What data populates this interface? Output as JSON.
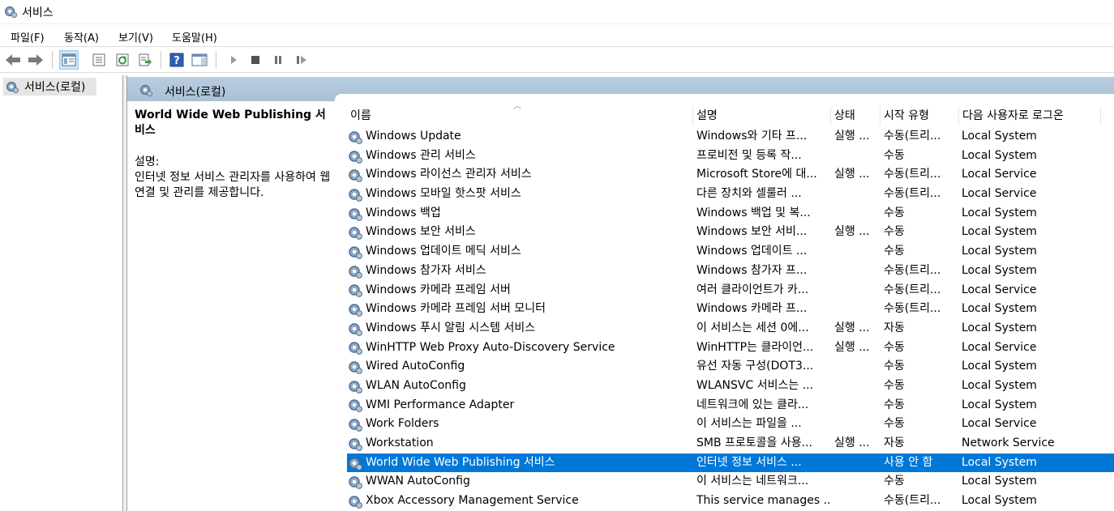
{
  "window": {
    "title": "서비스"
  },
  "menu": [
    {
      "label": "파일(F)"
    },
    {
      "label": "동작(A)"
    },
    {
      "label": "보기(V)"
    },
    {
      "label": "도움말(H)"
    }
  ],
  "toolbar": {
    "buttons": [
      {
        "name": "back-icon"
      },
      {
        "name": "forward-icon"
      },
      {
        "name": "show-hide-console-tree-icon",
        "active": true
      },
      {
        "name": "properties-icon"
      },
      {
        "name": "refresh-icon"
      },
      {
        "name": "export-list-icon"
      },
      {
        "name": "help-icon"
      },
      {
        "name": "show-action-pane-icon"
      },
      {
        "name": "play-icon"
      },
      {
        "name": "stop-icon"
      },
      {
        "name": "pause-icon"
      },
      {
        "name": "restart-icon"
      }
    ]
  },
  "tree": {
    "root_label": "서비스(로컬)"
  },
  "content": {
    "header_title": "서비스(로컬)",
    "selected_service": {
      "title": "World Wide Web Publishing 서비스",
      "desc_label": "설명:",
      "desc_text": "인터넷 정보 서비스 관리자를 사용하여 웹 연결 및 관리를 제공합니다."
    }
  },
  "list": {
    "columns": [
      "이름",
      "설명",
      "상태",
      "시작 유형",
      "다음 사용자로 로그온"
    ],
    "rows": [
      {
        "name": "Windows Update",
        "desc": "Windows와 기타 프...",
        "status": "실행 ...",
        "start": "수동(트리...",
        "logon": "Local System"
      },
      {
        "name": "Windows 관리 서비스",
        "desc": "프로비전 및 등록 작...",
        "status": "",
        "start": "수동",
        "logon": "Local System"
      },
      {
        "name": "Windows 라이선스 관리자 서비스",
        "desc": "Microsoft Store에 대...",
        "status": "실행 ...",
        "start": "수동(트리...",
        "logon": "Local Service"
      },
      {
        "name": "Windows 모바일 핫스팟 서비스",
        "desc": "다른 장치와 셀룰러 ...",
        "status": "",
        "start": "수동(트리...",
        "logon": "Local Service"
      },
      {
        "name": "Windows 백업",
        "desc": "Windows 백업 및 복...",
        "status": "",
        "start": "수동",
        "logon": "Local System"
      },
      {
        "name": "Windows 보안 서비스",
        "desc": "Windows 보안 서비...",
        "status": "실행 ...",
        "start": "수동",
        "logon": "Local System"
      },
      {
        "name": "Windows 업데이트 메딕 서비스",
        "desc": "Windows 업데이트 ...",
        "status": "",
        "start": "수동",
        "logon": "Local System"
      },
      {
        "name": "Windows 참가자 서비스",
        "desc": "Windows 참가자 프...",
        "status": "",
        "start": "수동(트리...",
        "logon": "Local System"
      },
      {
        "name": "Windows 카메라 프레임 서버",
        "desc": "여러 클라이언트가 카...",
        "status": "",
        "start": "수동(트리...",
        "logon": "Local Service"
      },
      {
        "name": "Windows 카메라 프레임 서버 모니터",
        "desc": "Windows 카메라 프...",
        "status": "",
        "start": "수동(트리...",
        "logon": "Local System"
      },
      {
        "name": "Windows 푸시 알림 시스템 서비스",
        "desc": "이 서비스는 세션 0에...",
        "status": "실행 ...",
        "start": "자동",
        "logon": "Local System"
      },
      {
        "name": "WinHTTP Web Proxy Auto-Discovery Service",
        "desc": "WinHTTP는 클라이언...",
        "status": "실행 ...",
        "start": "수동",
        "logon": "Local Service"
      },
      {
        "name": "Wired AutoConfig",
        "desc": "유선 자동 구성(DOT3...",
        "status": "",
        "start": "수동",
        "logon": "Local System"
      },
      {
        "name": "WLAN AutoConfig",
        "desc": "WLANSVC 서비스는 ...",
        "status": "",
        "start": "수동",
        "logon": "Local System"
      },
      {
        "name": "WMI Performance Adapter",
        "desc": "네트워크에 있는 클라...",
        "status": "",
        "start": "수동",
        "logon": "Local System"
      },
      {
        "name": "Work Folders",
        "desc": "이 서비스는 파일을 ...",
        "status": "",
        "start": "수동",
        "logon": "Local Service"
      },
      {
        "name": "Workstation",
        "desc": "SMB 프로토콜을 사용...",
        "status": "실행 ...",
        "start": "자동",
        "logon": "Network Service"
      },
      {
        "name": "World Wide Web Publishing 서비스",
        "desc": "인터넷 정보 서비스 ...",
        "status": "",
        "start": "사용 안 함",
        "logon": "Local System",
        "selected": true
      },
      {
        "name": "WWAN AutoConfig",
        "desc": "이 서비스는 네트워크...",
        "status": "",
        "start": "수동",
        "logon": "Local System"
      },
      {
        "name": "Xbox Accessory Management Service",
        "desc": "This service manages ...",
        "status": "",
        "start": "수동(트리...",
        "logon": "Local System"
      }
    ]
  },
  "colors": {
    "selection": "#0078d7",
    "header_band": "#b9cde0"
  }
}
